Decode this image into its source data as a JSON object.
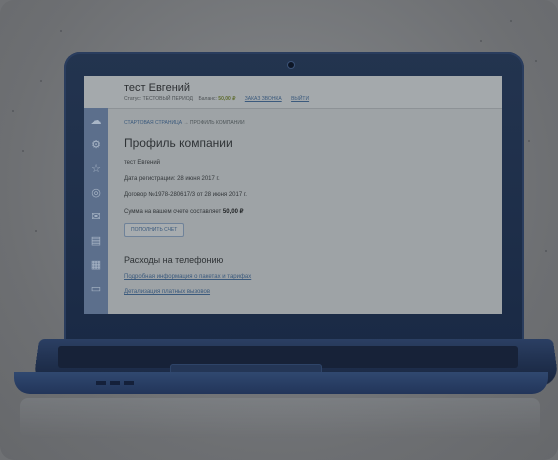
{
  "header": {
    "user_name": "тест Евгений",
    "status_label": "Статус:",
    "status_value": "ТЕСТОВЫЙ ПЕРИОД",
    "balance_label": "Баланс:",
    "balance_value": "50,00 ₽",
    "callback_link": "ЗАКАЗ ЗВОНКА",
    "logout_link": "ВЫЙТИ"
  },
  "breadcrumb": {
    "home": "СТАРТОВАЯ СТРАНИЦА",
    "separator": "→",
    "current": "ПРОФИЛЬ КОМПАНИИ"
  },
  "profile": {
    "title": "Профиль компании",
    "name": "тест Евгений",
    "registration": "Дата регистрации: 28 июня 2017 г.",
    "contract": "Договор №1978-280617/3 от 28 июня 2017 г.",
    "balance_text": "Сумма на вашем счете составляет",
    "balance_amount": "50,00 ₽",
    "topup_button": "ПОПОЛНИТЬ СЧЕТ"
  },
  "phone": {
    "title": "Расходы на телефонию",
    "link_plans": "Подробная информация о пакетах и тарифах",
    "link_calls": "Детализация платных вызовов"
  },
  "icons": [
    "logo-icon",
    "gear-icon",
    "star-icon",
    "circle-icon",
    "mail-icon",
    "chart-icon",
    "grid-icon",
    "car-icon"
  ]
}
